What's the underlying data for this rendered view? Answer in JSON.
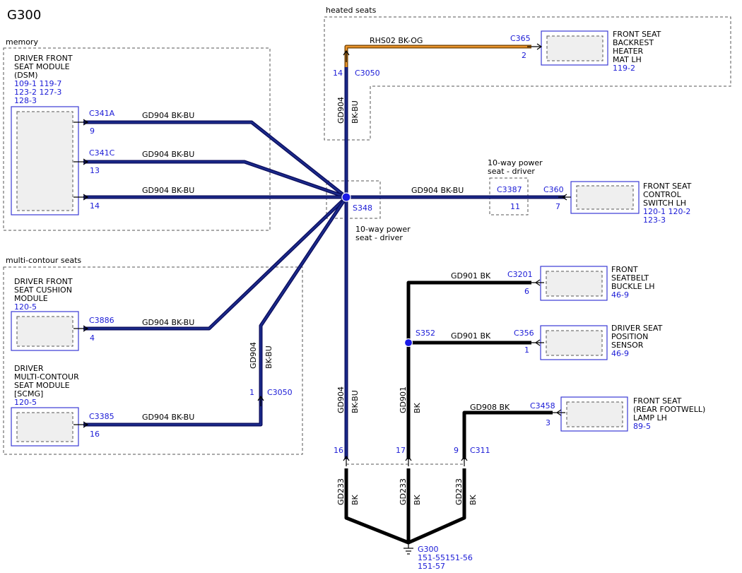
{
  "diagram": {
    "title": "G300",
    "groups": {
      "memory": "memory",
      "multi_contour": "multi-contour seats",
      "heated": "heated seats"
    },
    "components": {
      "dsm": {
        "lines": [
          "DRIVER FRONT",
          "SEAT MODULE",
          "(DSM)"
        ],
        "refs": [
          "109-1 119-7",
          "123-2 127-3",
          "128-3"
        ]
      },
      "cushion": {
        "lines": [
          "DRIVER FRONT",
          "SEAT CUSHION",
          "MODULE"
        ],
        "refs": [
          "120-5"
        ]
      },
      "scmg": {
        "lines": [
          "DRIVER",
          "MULTI-CONTOUR",
          "SEAT MODULE",
          "[SCMG]"
        ],
        "refs": [
          "120-5"
        ]
      },
      "backrest": {
        "lines": [
          "FRONT SEAT",
          "BACKREST",
          "HEATER",
          "MAT LH"
        ],
        "refs": [
          "119-2"
        ]
      },
      "control_switch": {
        "lines": [
          "FRONT SEAT",
          "CONTROL",
          "SWITCH LH"
        ],
        "refs": [
          "120-1 120-2",
          "123-3"
        ]
      },
      "buckle": {
        "lines": [
          "FRONT",
          "SEATBELT",
          "BUCKLE LH"
        ],
        "refs": [
          "46-9"
        ]
      },
      "position_sensor": {
        "lines": [
          "DRIVER SEAT",
          "POSITION",
          "SENSOR"
        ],
        "refs": [
          "46-9"
        ]
      },
      "footwell_lamp": {
        "lines": [
          "FRONT SEAT",
          "(REAR FOOTWELL)",
          "LAMP LH"
        ],
        "refs": [
          "89-5"
        ]
      }
    },
    "connectors": {
      "c341a": {
        "name": "C341A",
        "pin": "9"
      },
      "c341c": {
        "name": "C341C",
        "pin": "13"
      },
      "c341_14": {
        "pin": "14"
      },
      "c3886": {
        "name": "C3886",
        "pin": "4"
      },
      "c3385": {
        "name": "C3385",
        "pin": "16"
      },
      "c3050_left": {
        "name": "C3050",
        "pin": "1"
      },
      "c3050_top": {
        "name": "C3050",
        "pin": "14"
      },
      "c365": {
        "name": "C365",
        "pin": "2"
      },
      "c3387": {
        "name": "C3387",
        "pin": "11"
      },
      "c360": {
        "name": "C360",
        "pin": "7"
      },
      "c3201": {
        "name": "C3201",
        "pin": "6"
      },
      "c356": {
        "name": "C356",
        "pin": "1"
      },
      "c3458": {
        "name": "C3458",
        "pin": "3"
      },
      "c311": {
        "name": "C311",
        "pins": [
          "16",
          "17",
          "9"
        ]
      }
    },
    "splices": {
      "s348": "S348",
      "s352": "S352"
    },
    "option_labels": {
      "power_seat_1": [
        "10-way power",
        "seat - driver"
      ],
      "power_seat_2": [
        "10-way power",
        "seat - driver"
      ]
    },
    "wires": {
      "gd904": "GD904",
      "bk_bu": "BK-BU",
      "gd904_bkbu": "GD904  BK-BU",
      "rhs02": "RHS02  BK-OG",
      "gd901_bk": "GD901  BK",
      "gd901": "GD901",
      "gd908_bk": "GD908  BK",
      "gd233": "GD233",
      "bk": "BK"
    },
    "ground": {
      "name": "G300",
      "refs": [
        "151-55151-56",
        "151-57"
      ]
    },
    "colors": {
      "black_blue_wire": "#0a0a5a",
      "black_orange_wire": "#e8932a",
      "reference_text": "#1a1ad6",
      "splice": "#1a1ae6"
    }
  }
}
